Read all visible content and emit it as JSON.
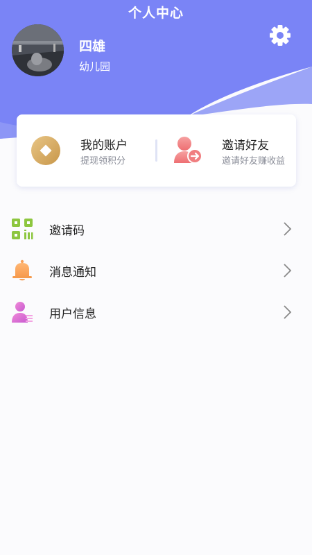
{
  "header": {
    "title": "个人中心",
    "bg_color": "#7a84f6",
    "wave_color": "#9aa3f7"
  },
  "profile": {
    "name": "四雄",
    "subtitle": "幼儿园"
  },
  "account_card": {
    "account": {
      "title": "我的账户",
      "subtitle": "提现领积分",
      "icon": "gold-coin-icon"
    },
    "invite": {
      "title": "邀请好友",
      "subtitle": "邀请好友赚收益",
      "icon": "invite-friend-icon"
    }
  },
  "menu": {
    "items": [
      {
        "label": "邀请码",
        "icon": "qr-code-icon"
      },
      {
        "label": "消息通知",
        "icon": "bell-icon"
      },
      {
        "label": "用户信息",
        "icon": "user-info-icon"
      }
    ]
  }
}
